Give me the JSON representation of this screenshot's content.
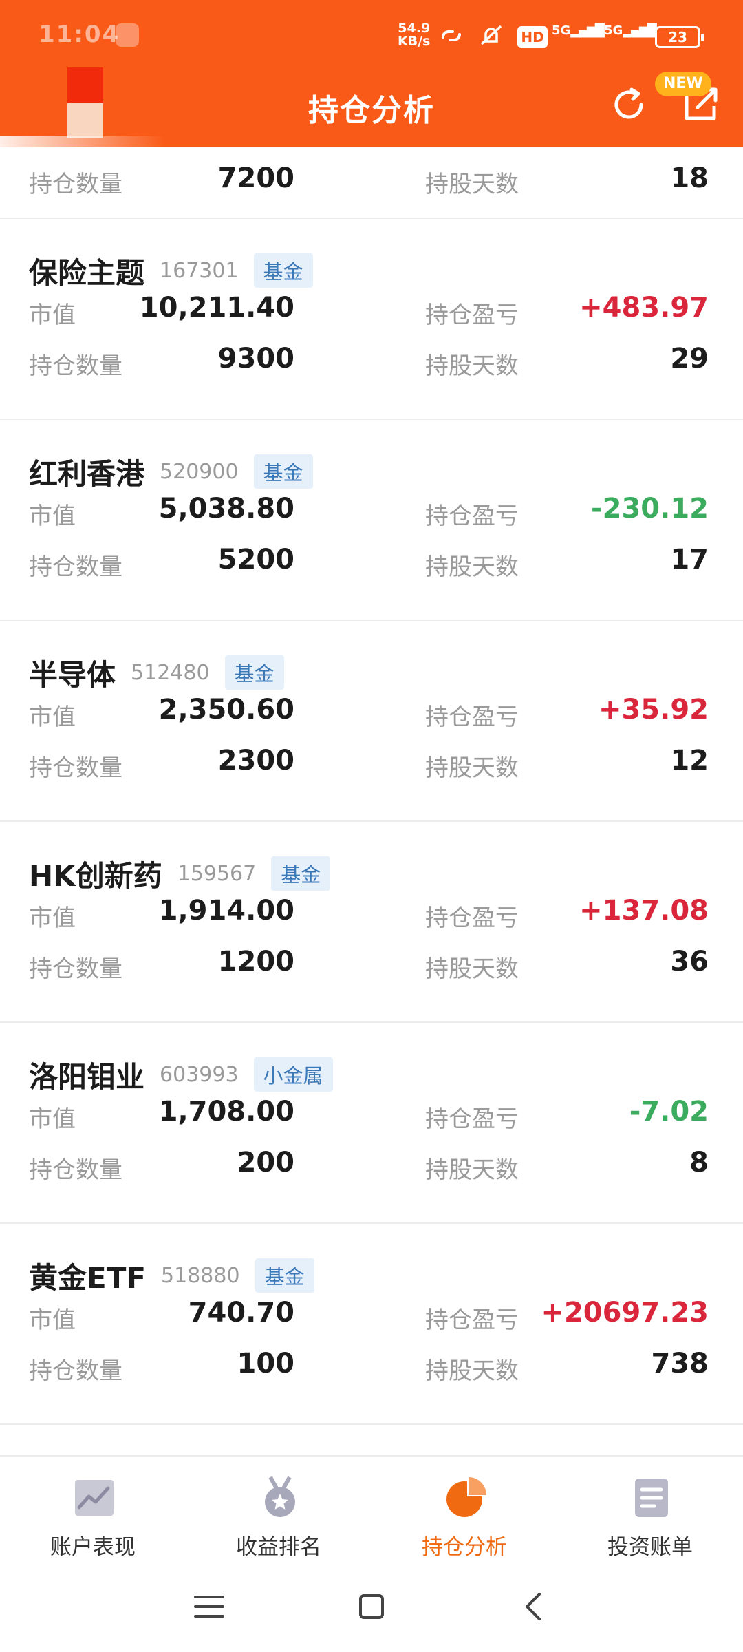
{
  "status_bar": {
    "time": "11:04",
    "speed_value": "54.9",
    "speed_unit": "KB/s",
    "hd": "HD",
    "signal1": "5G",
    "signal2": "5G",
    "battery": "23"
  },
  "header": {
    "title": "持仓分析",
    "new_badge": "NEW"
  },
  "top_row": {
    "label_qty": "持仓数量",
    "qty": "7200",
    "label_days": "持股天数",
    "days": "18"
  },
  "holdings": [
    {
      "name": "保险主题",
      "code": "167301",
      "tag": "基金",
      "market_value_label": "市值",
      "market_value": "10,211.40",
      "pnl_label": "持仓盈亏",
      "pnl": "+483.97",
      "qty_label": "持仓数量",
      "qty": "9300",
      "days_label": "持股天数",
      "days": "29"
    },
    {
      "name": "红利香港",
      "code": "520900",
      "tag": "基金",
      "market_value_label": "市值",
      "market_value": "5,038.80",
      "pnl_label": "持仓盈亏",
      "pnl": "-230.12",
      "qty_label": "持仓数量",
      "qty": "5200",
      "days_label": "持股天数",
      "days": "17"
    },
    {
      "name": "半导体",
      "code": "512480",
      "tag": "基金",
      "market_value_label": "市值",
      "market_value": "2,350.60",
      "pnl_label": "持仓盈亏",
      "pnl": "+35.92",
      "qty_label": "持仓数量",
      "qty": "2300",
      "days_label": "持股天数",
      "days": "12"
    },
    {
      "name": "HK创新药",
      "code": "159567",
      "tag": "基金",
      "market_value_label": "市值",
      "market_value": "1,914.00",
      "pnl_label": "持仓盈亏",
      "pnl": "+137.08",
      "qty_label": "持仓数量",
      "qty": "1200",
      "days_label": "持股天数",
      "days": "36"
    },
    {
      "name": "洛阳钼业",
      "code": "603993",
      "tag": "小金属",
      "market_value_label": "市值",
      "market_value": "1,708.00",
      "pnl_label": "持仓盈亏",
      "pnl": "-7.02",
      "qty_label": "持仓数量",
      "qty": "200",
      "days_label": "持股天数",
      "days": "8"
    },
    {
      "name": "黄金ETF",
      "code": "518880",
      "tag": "基金",
      "market_value_label": "市值",
      "market_value": "740.70",
      "pnl_label": "持仓盈亏",
      "pnl": "+20697.23",
      "qty_label": "持仓数量",
      "qty": "100",
      "days_label": "持股天数",
      "days": "738"
    }
  ],
  "colors": {
    "brand": "#fa5a17",
    "gain": "#d9263b",
    "loss": "#3bab5e",
    "tag_text": "#3a78b8",
    "tag_bg": "#e6f0fa",
    "active_tab": "#f06a12"
  },
  "bottom_nav": [
    {
      "label": "账户表现",
      "icon": "chart-trend-icon"
    },
    {
      "label": "收益排名",
      "icon": "medal-icon"
    },
    {
      "label": "持仓分析",
      "icon": "pie-chart-icon"
    },
    {
      "label": "投资账单",
      "icon": "document-icon"
    }
  ],
  "active_tab_index": 2
}
